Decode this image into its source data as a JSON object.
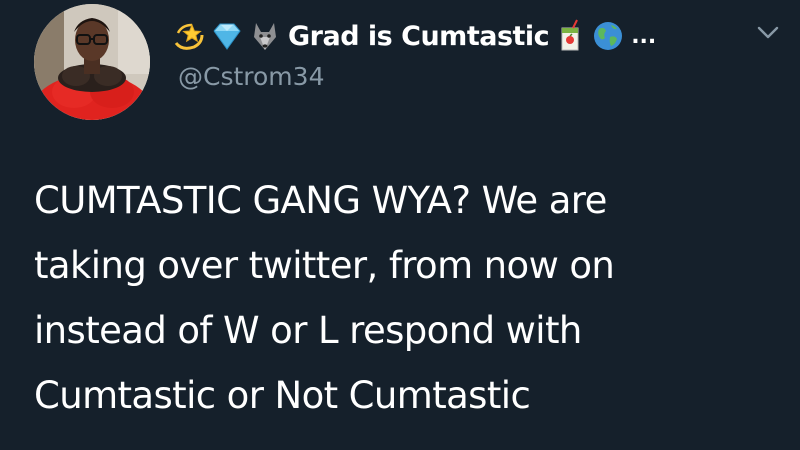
{
  "tweet": {
    "author": {
      "display_name": "Grad is Cumtastic",
      "handle": "@Cstrom34",
      "name_emojis_before": [
        "dizzy-star-icon",
        "gem-icon",
        "wolf-icon"
      ],
      "name_emojis_after": [
        "juice-box-icon",
        "globe-icon"
      ],
      "truncation": "..."
    },
    "body_lines": [
      "CUMTASTIC GANG WYA? We are",
      "taking over twitter, from now on",
      "instead of W or L respond with",
      "Cumtastic or Not Cumtastic"
    ]
  },
  "colors": {
    "background": "#15202b",
    "text": "#ffffff",
    "secondary_text": "#8899a6"
  }
}
